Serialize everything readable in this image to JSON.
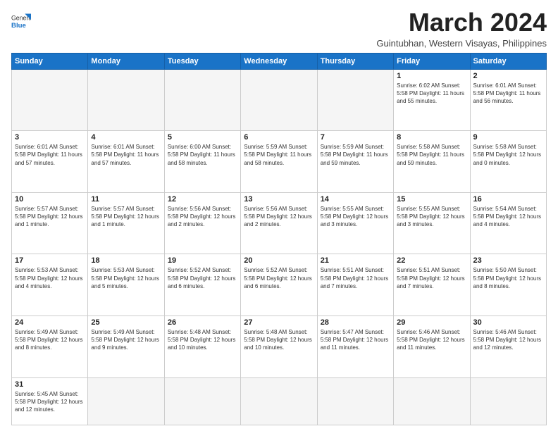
{
  "header": {
    "logo_general": "General",
    "logo_blue": "Blue",
    "month_title": "March 2024",
    "subtitle": "Guintubhan, Western Visayas, Philippines"
  },
  "weekdays": [
    "Sunday",
    "Monday",
    "Tuesday",
    "Wednesday",
    "Thursday",
    "Friday",
    "Saturday"
  ],
  "weeks": [
    [
      {
        "day": "",
        "info": ""
      },
      {
        "day": "",
        "info": ""
      },
      {
        "day": "",
        "info": ""
      },
      {
        "day": "",
        "info": ""
      },
      {
        "day": "",
        "info": ""
      },
      {
        "day": "1",
        "info": "Sunrise: 6:02 AM\nSunset: 5:58 PM\nDaylight: 11 hours\nand 55 minutes."
      },
      {
        "day": "2",
        "info": "Sunrise: 6:01 AM\nSunset: 5:58 PM\nDaylight: 11 hours\nand 56 minutes."
      }
    ],
    [
      {
        "day": "3",
        "info": "Sunrise: 6:01 AM\nSunset: 5:58 PM\nDaylight: 11 hours\nand 57 minutes."
      },
      {
        "day": "4",
        "info": "Sunrise: 6:01 AM\nSunset: 5:58 PM\nDaylight: 11 hours\nand 57 minutes."
      },
      {
        "day": "5",
        "info": "Sunrise: 6:00 AM\nSunset: 5:58 PM\nDaylight: 11 hours\nand 58 minutes."
      },
      {
        "day": "6",
        "info": "Sunrise: 5:59 AM\nSunset: 5:58 PM\nDaylight: 11 hours\nand 58 minutes."
      },
      {
        "day": "7",
        "info": "Sunrise: 5:59 AM\nSunset: 5:58 PM\nDaylight: 11 hours\nand 59 minutes."
      },
      {
        "day": "8",
        "info": "Sunrise: 5:58 AM\nSunset: 5:58 PM\nDaylight: 11 hours\nand 59 minutes."
      },
      {
        "day": "9",
        "info": "Sunrise: 5:58 AM\nSunset: 5:58 PM\nDaylight: 12 hours\nand 0 minutes."
      }
    ],
    [
      {
        "day": "10",
        "info": "Sunrise: 5:57 AM\nSunset: 5:58 PM\nDaylight: 12 hours\nand 1 minute."
      },
      {
        "day": "11",
        "info": "Sunrise: 5:57 AM\nSunset: 5:58 PM\nDaylight: 12 hours\nand 1 minute."
      },
      {
        "day": "12",
        "info": "Sunrise: 5:56 AM\nSunset: 5:58 PM\nDaylight: 12 hours\nand 2 minutes."
      },
      {
        "day": "13",
        "info": "Sunrise: 5:56 AM\nSunset: 5:58 PM\nDaylight: 12 hours\nand 2 minutes."
      },
      {
        "day": "14",
        "info": "Sunrise: 5:55 AM\nSunset: 5:58 PM\nDaylight: 12 hours\nand 3 minutes."
      },
      {
        "day": "15",
        "info": "Sunrise: 5:55 AM\nSunset: 5:58 PM\nDaylight: 12 hours\nand 3 minutes."
      },
      {
        "day": "16",
        "info": "Sunrise: 5:54 AM\nSunset: 5:58 PM\nDaylight: 12 hours\nand 4 minutes."
      }
    ],
    [
      {
        "day": "17",
        "info": "Sunrise: 5:53 AM\nSunset: 5:58 PM\nDaylight: 12 hours\nand 4 minutes."
      },
      {
        "day": "18",
        "info": "Sunrise: 5:53 AM\nSunset: 5:58 PM\nDaylight: 12 hours\nand 5 minutes."
      },
      {
        "day": "19",
        "info": "Sunrise: 5:52 AM\nSunset: 5:58 PM\nDaylight: 12 hours\nand 6 minutes."
      },
      {
        "day": "20",
        "info": "Sunrise: 5:52 AM\nSunset: 5:58 PM\nDaylight: 12 hours\nand 6 minutes."
      },
      {
        "day": "21",
        "info": "Sunrise: 5:51 AM\nSunset: 5:58 PM\nDaylight: 12 hours\nand 7 minutes."
      },
      {
        "day": "22",
        "info": "Sunrise: 5:51 AM\nSunset: 5:58 PM\nDaylight: 12 hours\nand 7 minutes."
      },
      {
        "day": "23",
        "info": "Sunrise: 5:50 AM\nSunset: 5:58 PM\nDaylight: 12 hours\nand 8 minutes."
      }
    ],
    [
      {
        "day": "24",
        "info": "Sunrise: 5:49 AM\nSunset: 5:58 PM\nDaylight: 12 hours\nand 8 minutes."
      },
      {
        "day": "25",
        "info": "Sunrise: 5:49 AM\nSunset: 5:58 PM\nDaylight: 12 hours\nand 9 minutes."
      },
      {
        "day": "26",
        "info": "Sunrise: 5:48 AM\nSunset: 5:58 PM\nDaylight: 12 hours\nand 10 minutes."
      },
      {
        "day": "27",
        "info": "Sunrise: 5:48 AM\nSunset: 5:58 PM\nDaylight: 12 hours\nand 10 minutes."
      },
      {
        "day": "28",
        "info": "Sunrise: 5:47 AM\nSunset: 5:58 PM\nDaylight: 12 hours\nand 11 minutes."
      },
      {
        "day": "29",
        "info": "Sunrise: 5:46 AM\nSunset: 5:58 PM\nDaylight: 12 hours\nand 11 minutes."
      },
      {
        "day": "30",
        "info": "Sunrise: 5:46 AM\nSunset: 5:58 PM\nDaylight: 12 hours\nand 12 minutes."
      }
    ],
    [
      {
        "day": "31",
        "info": "Sunrise: 5:45 AM\nSunset: 5:58 PM\nDaylight: 12 hours\nand 12 minutes."
      },
      {
        "day": "",
        "info": ""
      },
      {
        "day": "",
        "info": ""
      },
      {
        "day": "",
        "info": ""
      },
      {
        "day": "",
        "info": ""
      },
      {
        "day": "",
        "info": ""
      },
      {
        "day": "",
        "info": ""
      }
    ]
  ]
}
